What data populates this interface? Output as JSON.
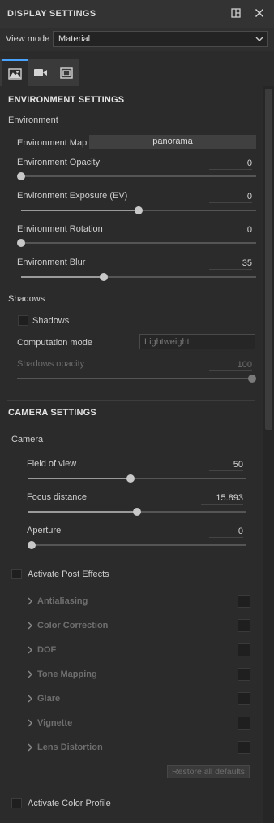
{
  "title": "DISPLAY SETTINGS",
  "view_mode": {
    "label": "View mode",
    "value": "Material"
  },
  "tabs": [
    {
      "icon": "image-icon"
    },
    {
      "icon": "camera-icon"
    },
    {
      "icon": "frame-icon"
    }
  ],
  "environment_settings": {
    "heading": "ENVIRONMENT SETTINGS",
    "group": "Environment",
    "map_label": "Environment Map",
    "map_value": "panorama",
    "opacity": {
      "label": "Environment Opacity",
      "value": "0",
      "fraction": 0.0
    },
    "exposure": {
      "label": "Environment Exposure (EV)",
      "value": "0",
      "fraction": 0.5
    },
    "rotation": {
      "label": "Environment Rotation",
      "value": "0",
      "fraction": 0.0
    },
    "blur": {
      "label": "Environment Blur",
      "value": "35",
      "fraction": 0.35
    }
  },
  "shadows": {
    "group": "Shadows",
    "checkbox_label": "Shadows",
    "computation_label": "Computation mode",
    "computation_value": "Lightweight",
    "opacity_label": "Shadows opacity",
    "opacity_value": "100",
    "opacity_fraction": 1.0
  },
  "camera_settings": {
    "heading": "CAMERA SETTINGS",
    "group": "Camera",
    "fov": {
      "label": "Field of view",
      "value": "50",
      "fraction": 0.47
    },
    "focus": {
      "label": "Focus distance",
      "value": "15.893",
      "fraction": 0.5
    },
    "aperture": {
      "label": "Aperture",
      "value": "0",
      "fraction": 0.0
    }
  },
  "post_effects": {
    "label": "Activate Post Effects",
    "items": [
      "Antialiasing",
      "Color Correction",
      "DOF",
      "Tone Mapping",
      "Glare",
      "Vignette",
      "Lens Distortion"
    ],
    "restore_label": "Restore all defaults"
  },
  "color_profile": {
    "label": "Activate Color Profile"
  }
}
